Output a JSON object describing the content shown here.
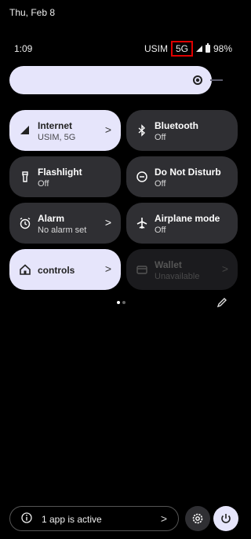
{
  "status_bar": {
    "date": "Thu, Feb 8",
    "time": "1:09",
    "carrier": "USIM",
    "network": "5G",
    "battery": "98%"
  },
  "brightness": {
    "level": 0.88
  },
  "tiles": [
    {
      "title": "Internet",
      "subtitle": "USIM, 5G",
      "chevron": ">"
    },
    {
      "title": "Bluetooth",
      "subtitle": "Off"
    },
    {
      "title": "Flashlight",
      "subtitle": "Off"
    },
    {
      "title": "Do Not Disturb",
      "subtitle": "Off"
    },
    {
      "title": "Alarm",
      "subtitle": "No alarm set",
      "chevron": ">"
    },
    {
      "title": "Airplane mode",
      "subtitle": "Off"
    },
    {
      "title": "controls",
      "chevron": ">"
    },
    {
      "title": "Wallet",
      "subtitle": "Unavailable",
      "chevron": ">"
    }
  ],
  "footer": {
    "active_apps_label": "1 app is active",
    "chevron": ">"
  },
  "colors": {
    "tile_on": "#e6e5fb",
    "tile_off": "#2f2f33",
    "highlight": "#e00000"
  }
}
